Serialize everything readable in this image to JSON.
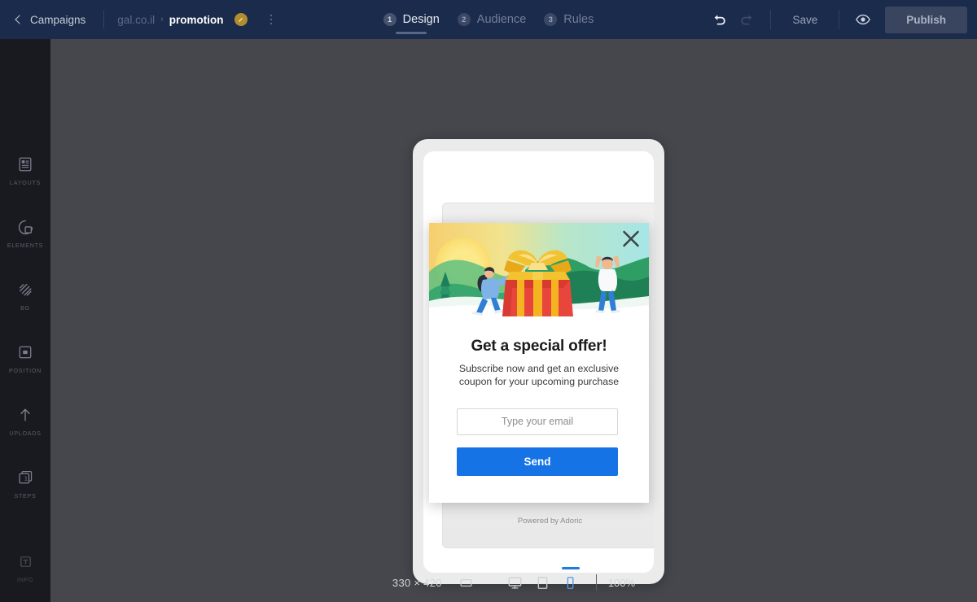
{
  "topbar": {
    "back_label": "Campaigns",
    "breadcrumb": {
      "site": "gal.co.il",
      "separator": "›",
      "name": "promotion"
    },
    "steps": [
      {
        "num": "1",
        "label": "Design",
        "active": true
      },
      {
        "num": "2",
        "label": "Audience",
        "active": false
      },
      {
        "num": "3",
        "label": "Rules",
        "active": false
      }
    ],
    "undo_icon": "undo-arrow-icon",
    "redo_icon": "redo-arrow-icon",
    "save_label": "Save",
    "preview_icon": "eye-icon",
    "publish_label": "Publish",
    "badge_icon": "edit-pencil-badge",
    "menu_icon": "kebab-menu-icon"
  },
  "sidebar": {
    "items": [
      {
        "label": "LAYOUTS",
        "icon": "layouts-icon"
      },
      {
        "label": "ELEMENTS",
        "icon": "elements-icon"
      },
      {
        "label": "BG",
        "icon": "background-icon"
      },
      {
        "label": "POSITION",
        "icon": "position-icon"
      },
      {
        "label": "UPLOADS",
        "icon": "upload-arrow-icon"
      },
      {
        "label": "STEPS",
        "icon": "steps-icon"
      }
    ],
    "bottom_item": {
      "label": "INFO",
      "icon": "text-info-icon"
    }
  },
  "canvas": {
    "phone_placeholder_powered": "Powered by Adoric",
    "popup": {
      "close_icon": "close-x-icon",
      "title": "Get a special offer!",
      "subtitle": "Subscribe now and get an exclusive coupon for your upcoming purchase",
      "email_placeholder": "Type your email",
      "email_value": "",
      "send_label": "Send",
      "hero_alt": "gift-box-illustration"
    }
  },
  "bottombar": {
    "size_label": "330 × 420",
    "size_icon": "resize-rectangle-icon",
    "devices": [
      {
        "name": "desktop",
        "icon": "monitor-icon",
        "active": false
      },
      {
        "name": "tablet",
        "icon": "tablet-icon",
        "active": false
      },
      {
        "name": "mobile",
        "icon": "mobile-icon",
        "active": true
      }
    ],
    "zoom_label": "100%"
  },
  "colors": {
    "topbar_bg": "#1b2b4b",
    "sidebar_bg": "#181a20",
    "canvas_bg": "#45474d",
    "accent_blue": "#1573e6",
    "badge_gold": "#b08d2e",
    "device_active": "#1f7be0"
  }
}
